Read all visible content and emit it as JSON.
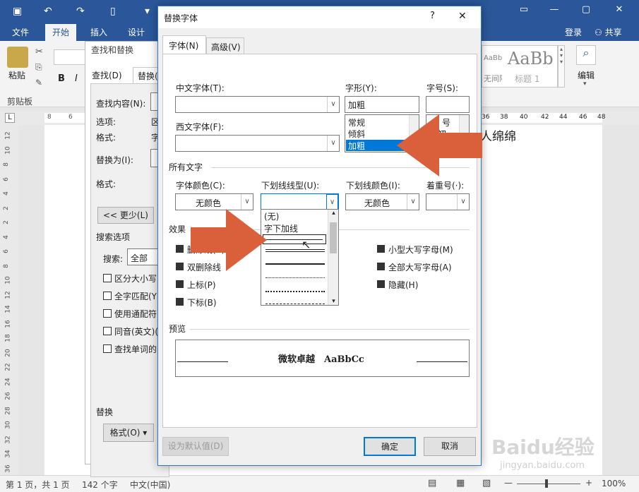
{
  "word": {
    "tabs": [
      "文件",
      "开始",
      "插入",
      "设计"
    ],
    "login": "登录",
    "share": "共享",
    "clipboard_group": "剪贴板",
    "paste_label": "粘贴",
    "bold": "B",
    "italic": "I",
    "style_preview": "AaBb",
    "style_label": "标题 1",
    "style_small": "AaBbCcDdE",
    "style_small_label": "无间隔",
    "edit_label": "编辑",
    "doc_text": "人绵绵",
    "ruler_numbers": [
      "8",
      "6",
      "4",
      "2",
      "36",
      "38",
      "40",
      "42",
      "44",
      "46",
      "48"
    ],
    "vruler_numbers": [
      "12",
      "10",
      "8",
      "6",
      "4",
      "2",
      "2",
      "4",
      "6",
      "8",
      "10",
      "12",
      "14",
      "16",
      "18",
      "20",
      "22",
      "24",
      "26",
      "28",
      "30",
      "32",
      "34",
      "36"
    ],
    "status": {
      "page": "第 1 页，共 1 页",
      "words": "142 个字",
      "lang": "中文(中国)",
      "zoom": "100%"
    }
  },
  "findreplace": {
    "title": "查找和替换",
    "tab_find": "查找(D)",
    "tab_replace": "替换(",
    "find_label": "查找内容(N):",
    "options_label": "选项:",
    "options_value": "区",
    "format_label": "格式:",
    "format_value": "字",
    "replace_label": "替换为(I):",
    "format_label2": "格式:",
    "less_button": "<< 更少(L)",
    "search_options": "搜索选项",
    "search_label": "搜索:",
    "search_value": "全部",
    "checks": [
      "区分大小写",
      "全字匹配(Y)",
      "使用通配符",
      "同音(英文)(",
      "查找单词的"
    ],
    "replace_section": "替换",
    "format_button": "格式(O) ▾"
  },
  "fontdlg": {
    "title": "替换字体",
    "help": "?",
    "close": "✕",
    "tab_font": "字体(N)",
    "tab_advanced": "高级(V)",
    "cn_font_label": "中文字体(T):",
    "west_font_label": "西文字体(F):",
    "style_label": "字形(Y):",
    "style_value": "加粗",
    "style_options": [
      "常规",
      "倾斜",
      "加粗"
    ],
    "size_label": "字号(S):",
    "size_options": [
      "号",
      "小初"
    ],
    "all_text_label": "所有文字",
    "font_color_label": "字体颜色(C):",
    "font_color_value": "无颜色",
    "underline_style_label": "下划线线型(U):",
    "underline_options": [
      "(无)",
      "字下加线"
    ],
    "underline_color_label": "下划线颜色(I):",
    "underline_color_value": "无颜色",
    "emphasis_label": "着重号(·):",
    "effects_label": "效果",
    "effects": [
      "删除线(K)",
      "双删除线",
      "上标(P)",
      "下标(B)"
    ],
    "effects_right": [
      "小型大写字母(M)",
      "全部大写字母(A)",
      "隐藏(H)"
    ],
    "preview_label": "预览",
    "preview_text": "微软卓越　AaBbCc",
    "default_button": "设为默认值(D)",
    "ok_button": "确定",
    "cancel_button": "取消"
  },
  "watermark": {
    "brand": "Baidu经验",
    "url": "jingyan.baidu.com"
  },
  "colors": {
    "word_blue": "#2b579a",
    "accent_arrow": "#d9603b",
    "select_blue": "#0078d7"
  }
}
